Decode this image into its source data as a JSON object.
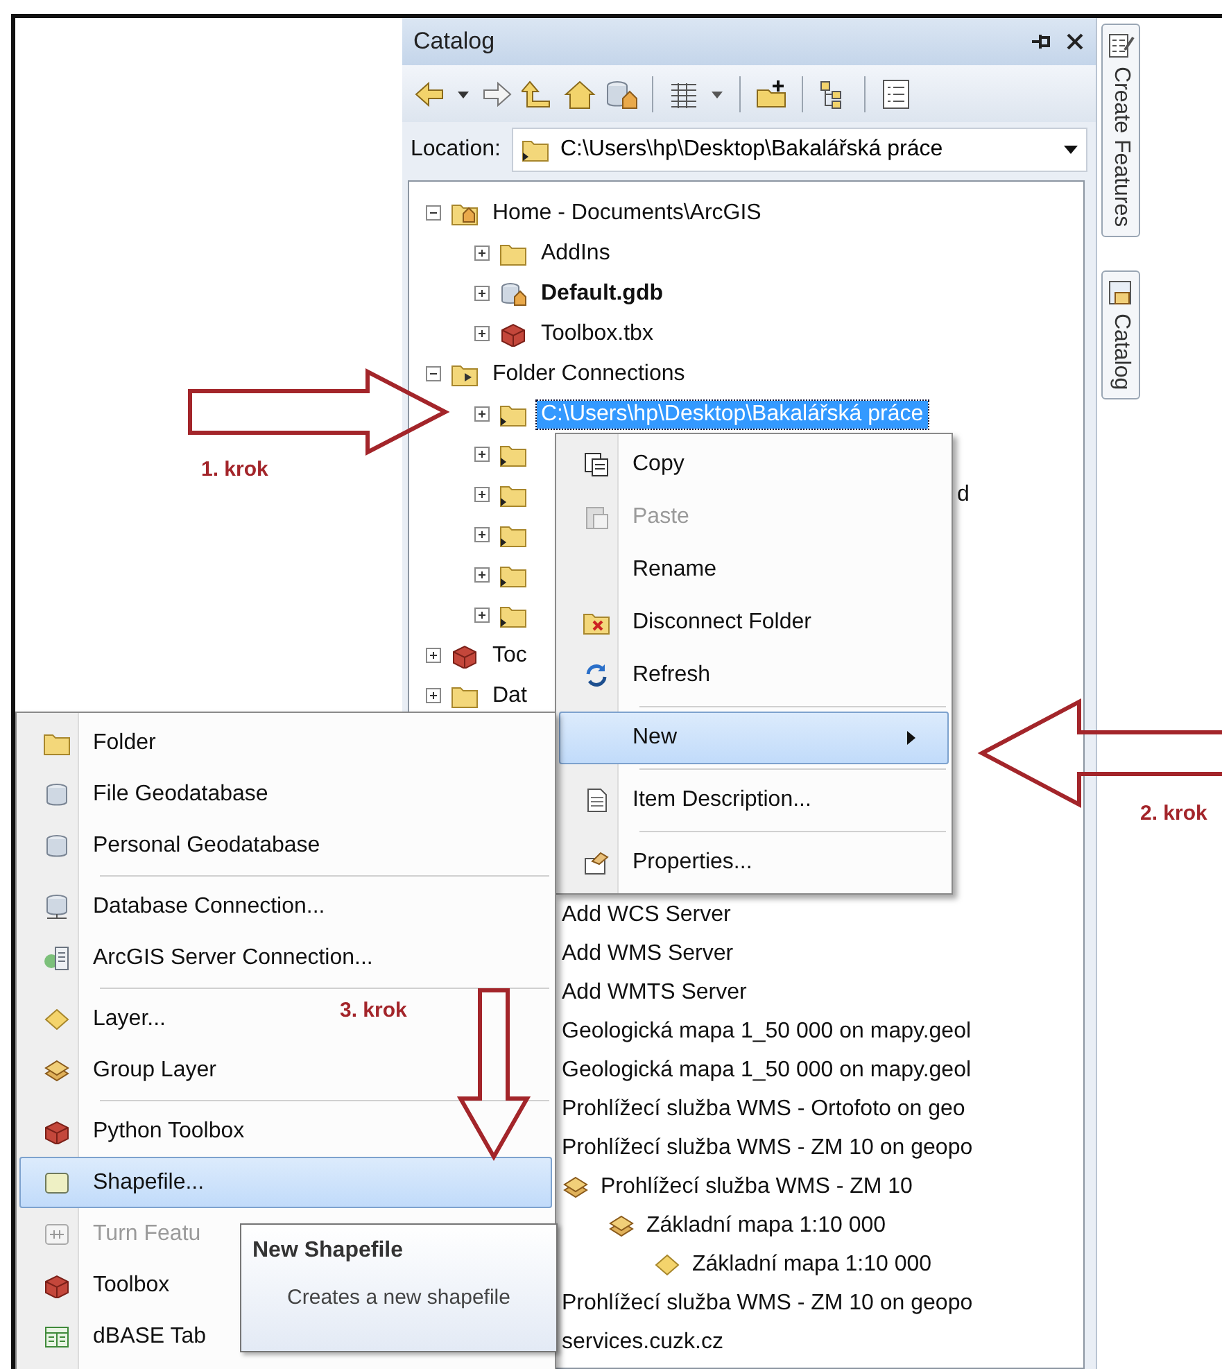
{
  "catalog": {
    "title": "Catalog",
    "location_label": "Location:",
    "location": "C:\\Users\\hp\\Desktop\\Bakalářská práce",
    "tree": [
      {
        "label": "Home - Documents\\ArcGIS",
        "kind": "home_folder",
        "expanded": true,
        "selected": false,
        "children": [
          {
            "label": "AddIns",
            "kind": "folder",
            "expanded": false,
            "selected": false
          },
          {
            "label": "Default.gdb",
            "kind": "default_gdb",
            "expanded": false,
            "selected": false
          },
          {
            "label": "Toolbox.tbx",
            "kind": "toolbox",
            "expanded": false,
            "selected": false
          }
        ]
      },
      {
        "label": "Folder Connections",
        "kind": "folder_connections",
        "expanded": true,
        "selected": false,
        "children": [
          {
            "label": "C:\\Users\\hp\\Desktop\\Bakalářská práce",
            "kind": "folder_link",
            "expanded": false,
            "selected": true
          },
          {
            "kind": "folder_link",
            "expanded": false,
            "selected": false
          },
          {
            "tail": "d",
            "kind": "folder_link",
            "expanded": false,
            "selected": false
          },
          {
            "kind": "folder_link",
            "expanded": false,
            "selected": false
          },
          {
            "kind": "folder_link",
            "expanded": false,
            "selected": false
          },
          {
            "kind": "folder_link",
            "expanded": false,
            "selected": false
          }
        ]
      },
      {
        "label": "Toc",
        "kind": "toolbox",
        "expanded": false,
        "selected": false
      },
      {
        "label": "Dat",
        "kind": "folder",
        "expanded": false,
        "selected": false
      }
    ],
    "list": [
      {
        "label": "Add WCS Server"
      },
      {
        "label": "Add WMS Server"
      },
      {
        "label": "Add WMTS Server"
      },
      {
        "label": "Geologická mapa 1_50 000 on mapy.geol"
      },
      {
        "label": "Geologická mapa 1_50 000 on mapy.geol"
      },
      {
        "label": "Prohlížecí služba WMS - Ortofoto on geo"
      },
      {
        "label": "Prohlížecí služba WMS - ZM 10 on geopo"
      },
      {
        "label": "Prohlížecí služba WMS - ZM 10",
        "kind": "layers",
        "children": [
          {
            "label": "Základní mapa 1:10 000",
            "kind": "layers",
            "children": [
              {
                "label": "Základní mapa 1:10 000",
                "kind": "layer"
              }
            ]
          }
        ]
      },
      {
        "label": "Prohlížecí služba WMS - ZM 10 on geopo"
      },
      {
        "label": "services.cuzk.cz"
      }
    ]
  },
  "side_tabs": [
    {
      "label": "Create Features",
      "kind": "create_features"
    },
    {
      "label": "Catalog",
      "kind": "catalog"
    }
  ],
  "context_menu": {
    "items": [
      {
        "kind": "copy",
        "label": "Copy",
        "disabled": false,
        "selected": false,
        "submenu": false
      },
      {
        "kind": "paste",
        "label": "Paste",
        "disabled": true,
        "selected": false,
        "submenu": false
      },
      {
        "kind": "plain",
        "label": "Rename",
        "disabled": false,
        "selected": false,
        "submenu": false
      },
      {
        "kind": "disconnect",
        "label": "Disconnect Folder",
        "disabled": false,
        "selected": false,
        "submenu": false
      },
      {
        "kind": "refresh",
        "label": "Refresh",
        "disabled": false,
        "selected": false,
        "submenu": false
      },
      {
        "kind": "separator"
      },
      {
        "kind": "plain",
        "label": "New",
        "disabled": false,
        "selected": true,
        "submenu": true
      },
      {
        "kind": "separator"
      },
      {
        "kind": "document",
        "label": "Item Description...",
        "disabled": false,
        "selected": false,
        "submenu": false
      },
      {
        "kind": "separator"
      },
      {
        "kind": "properties",
        "label": "Properties...",
        "disabled": false,
        "selected": false,
        "submenu": false
      }
    ]
  },
  "new_menu": {
    "items": [
      {
        "kind": "folder",
        "label": "Folder",
        "disabled": false,
        "selected": false
      },
      {
        "kind": "cylinder",
        "label": "File Geodatabase",
        "disabled": false,
        "selected": false
      },
      {
        "kind": "cylinder",
        "label": "Personal Geodatabase",
        "disabled": false,
        "selected": false
      },
      {
        "kind": "separator"
      },
      {
        "kind": "db_connection",
        "label": "Database Connection...",
        "disabled": false,
        "selected": false
      },
      {
        "kind": "server",
        "label": "ArcGIS Server Connection...",
        "disabled": false,
        "selected": false
      },
      {
        "kind": "separator"
      },
      {
        "kind": "layer",
        "label": "Layer...",
        "disabled": false,
        "selected": false
      },
      {
        "kind": "layers",
        "label": "Group Layer",
        "disabled": false,
        "selected": false
      },
      {
        "kind": "separator"
      },
      {
        "kind": "toolbox",
        "label": "Python Toolbox",
        "disabled": false,
        "selected": false
      },
      {
        "kind": "shapefile",
        "label": "Shapefile...",
        "disabled": false,
        "selected": true
      },
      {
        "kind": "turn",
        "label": "Turn Featu",
        "disabled": true,
        "selected": false
      },
      {
        "kind": "toolbox",
        "label": "Toolbox",
        "disabled": false,
        "selected": false
      },
      {
        "kind": "table",
        "label": "dBASE Tab",
        "disabled": false,
        "selected": false
      }
    ]
  },
  "tooltip": {
    "title": "New Shapefile",
    "text": "Creates a new shapefile"
  },
  "annotations": [
    {
      "text": "1. krok",
      "kind": "right"
    },
    {
      "text": "2. krok",
      "kind": "left"
    },
    {
      "text": "3. krok",
      "kind": "down"
    }
  ]
}
